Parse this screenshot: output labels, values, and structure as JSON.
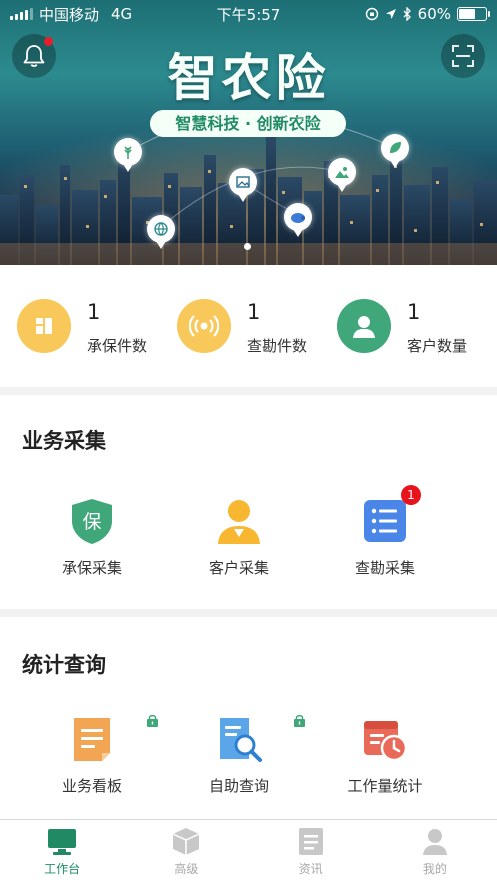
{
  "status_bar": {
    "carrier": "中国移动",
    "network": "4G",
    "time": "下午5:57",
    "battery": "60%",
    "battery_level": 0.6
  },
  "banner": {
    "title": "智农险",
    "slogan": "智慧科技 · 创新农险",
    "notification_icon": "bell-icon",
    "scan_icon": "scan-icon",
    "has_unread_notification": true
  },
  "stats": [
    {
      "value": "1",
      "label": "承保件数",
      "icon": "document-icon",
      "color": "#f8c85a"
    },
    {
      "value": "1",
      "label": "查勘件数",
      "icon": "signal-icon",
      "color": "#f8c85a"
    },
    {
      "value": "1",
      "label": "客户数量",
      "icon": "person-icon",
      "color": "#3fa779"
    }
  ],
  "business": {
    "title": "业务采集",
    "items": [
      {
        "label": "承保采集",
        "icon": "shield-icon",
        "icon_text": "保",
        "color": "#3fa779"
      },
      {
        "label": "客户采集",
        "icon": "user-icon",
        "color": "#f7b731"
      },
      {
        "label": "查勘采集",
        "icon": "list-icon",
        "color": "#4a86e8",
        "badge": "1"
      }
    ]
  },
  "statistics": {
    "title": "统计查询",
    "items": [
      {
        "label": "业务看板",
        "icon": "board-icon",
        "color": "#f2a654",
        "locked": true
      },
      {
        "label": "自助查询",
        "icon": "search-doc-icon",
        "color": "#5aa6e8",
        "locked": true
      },
      {
        "label": "工作量统计",
        "icon": "calendar-clock-icon",
        "color": "#ea6a5a",
        "locked": false
      }
    ]
  },
  "tabbar": {
    "items": [
      {
        "label": "工作台",
        "icon": "monitor-icon",
        "active": true
      },
      {
        "label": "高级",
        "icon": "cube-icon",
        "active": false
      },
      {
        "label": "资讯",
        "icon": "news-icon",
        "active": false
      },
      {
        "label": "我的",
        "icon": "profile-icon",
        "active": false
      }
    ],
    "active_color": "#1f8a63",
    "inactive_color": "#a8a8a8"
  }
}
